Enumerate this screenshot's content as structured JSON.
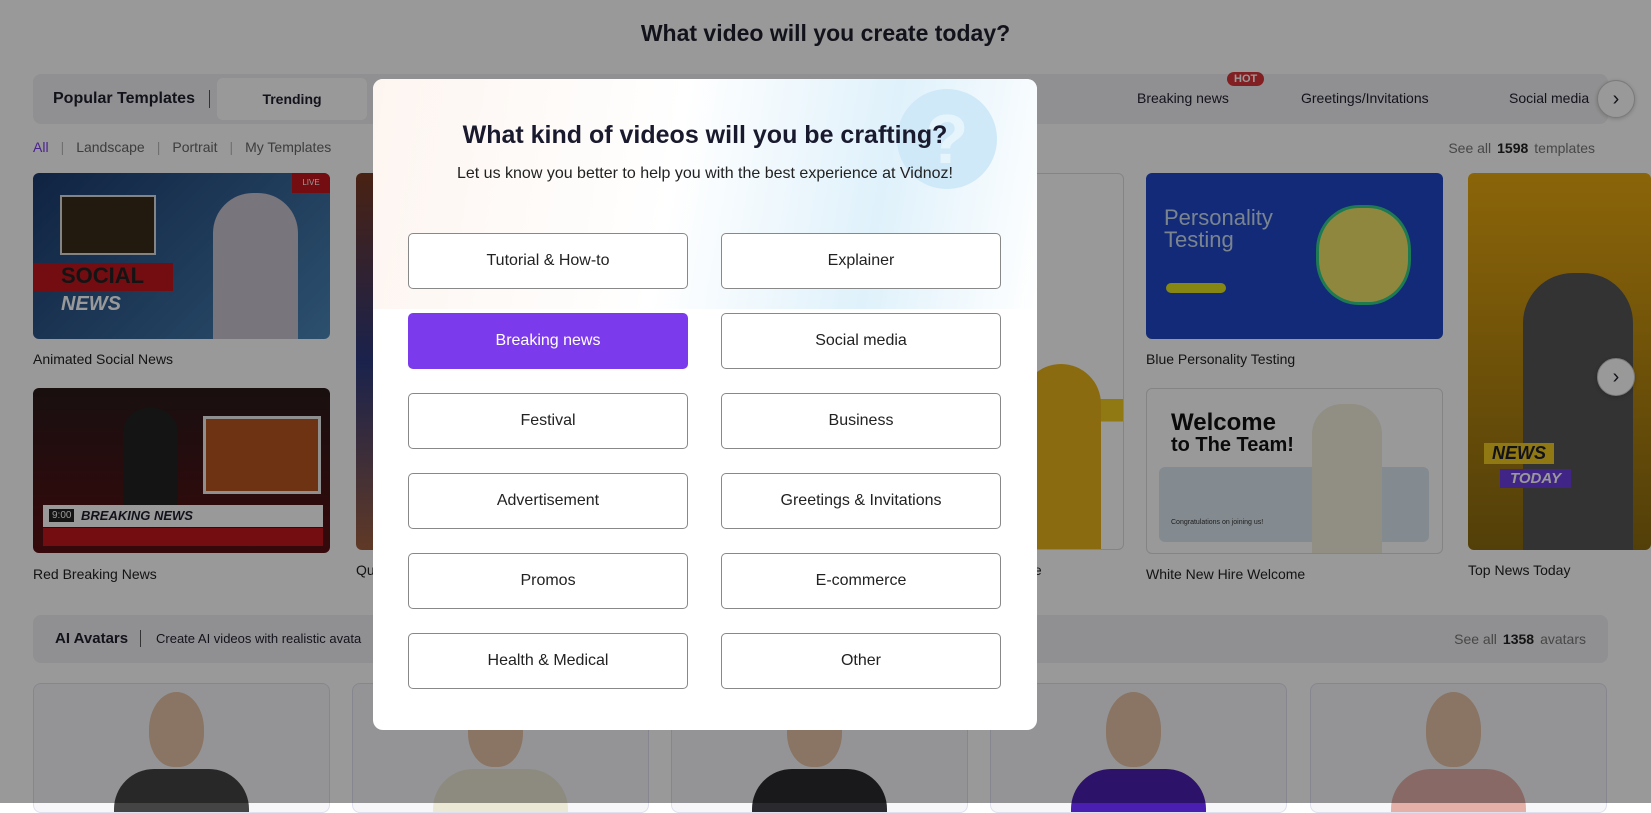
{
  "page": {
    "title": "What video will you create today?"
  },
  "categories": {
    "label": "Popular Templates",
    "items": [
      "Trending",
      "Tutorial & How-to",
      "Breaking news",
      "Greetings/Invitations",
      "Social media"
    ],
    "hot_badge": "HOT"
  },
  "filters": {
    "items": [
      "All",
      "Landscape",
      "Portrait",
      "My Templates"
    ],
    "see_all": "See all",
    "count": "1598",
    "unit": "templates"
  },
  "templates": [
    "Animated Social News",
    "Red Breaking News",
    "Qu",
    "te",
    "Blue Personality Testing",
    "White New Hire Welcome",
    "Top News Today"
  ],
  "thumb_text": {
    "social": "SOCIAL",
    "news": "NEWS",
    "live": "LIVE",
    "breaking": "BREAKING NEWS",
    "time": "9:00",
    "personality": "Personality Testing",
    "welcome": "Welcome",
    "to_team": "to The Team!",
    "congrats": "Congratulations on joining us!",
    "news2": "NEWS",
    "today": "TODAY"
  },
  "avatars": {
    "label": "AI Avatars",
    "desc": "Create AI videos with realistic avata",
    "see_all": "See all",
    "count": "1358",
    "unit": "avatars"
  },
  "modal": {
    "title": "What kind of videos will you be crafting?",
    "subtitle": "Let us know you better to help you with the best experience at Vidnoz!",
    "options": [
      "Tutorial & How-to",
      "Explainer",
      "Breaking news",
      "Social media",
      "Festival",
      "Business",
      "Advertisement",
      "Greetings & Invitations",
      "Promos",
      "E-commerce",
      "Health & Medical",
      "Other"
    ],
    "selected": "Breaking news"
  },
  "colors": {
    "accent": "#7c3aed",
    "hot": "#d9343a"
  }
}
